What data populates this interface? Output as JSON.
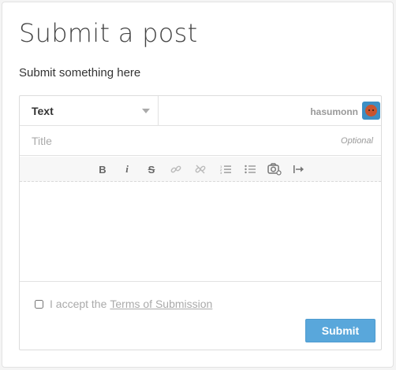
{
  "page": {
    "title": "Submit a post",
    "subtitle": "Submit something here"
  },
  "form": {
    "type_select": {
      "value": "Text"
    },
    "user": {
      "name": "hasumonn",
      "avatar_color": "#3d8fc4"
    },
    "title_field": {
      "placeholder": "Title",
      "hint": "Optional"
    },
    "toolbar": {
      "items": [
        "bold-icon",
        "italic-icon",
        "strikethrough-icon",
        "link-icon",
        "unlink-icon",
        "ordered-list-icon",
        "bullet-list-icon",
        "camera-icon",
        "indent-icon"
      ],
      "bold": "B",
      "italic": "i",
      "strike": "S"
    },
    "terms": {
      "prefix": "I accept the",
      "link": "Terms of Submission"
    },
    "submit_label": "Submit",
    "accent": "#59a7db"
  }
}
